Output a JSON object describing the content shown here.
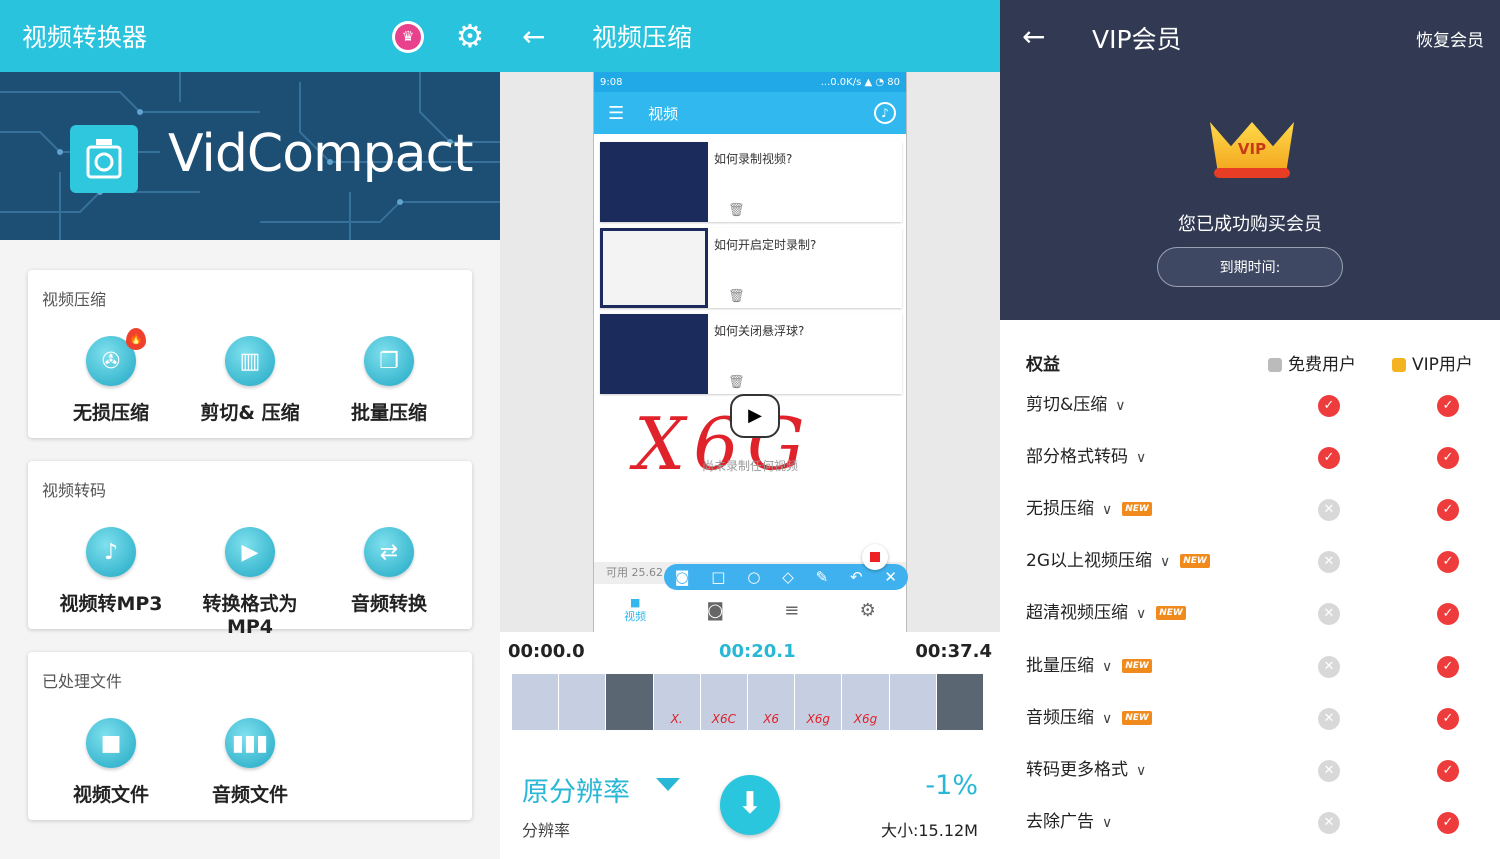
{
  "panel1": {
    "title": "视频转换器",
    "banner_brand": "VidCompact",
    "cards": [
      {
        "label": "视频压缩",
        "items": [
          "无损压缩",
          "剪切& 压缩",
          "批量压缩"
        ]
      },
      {
        "label": "视频转码",
        "items": [
          "视频转MP3",
          "转换格式为MP4",
          "音频转换"
        ]
      },
      {
        "label": "已处理文件",
        "items": [
          "视频文件",
          "音频文件"
        ]
      }
    ]
  },
  "panel2": {
    "title": "视频压缩",
    "phone": {
      "time": "9:08",
      "net": "...0.0K/s",
      "battery": "80",
      "tab_title": "视频",
      "videos": [
        "如何录制视频?",
        "如何开启定时录制?",
        "如何关闭悬浮球?"
      ],
      "empty_text": "尚未录制任何视频",
      "scrawl": "X6G",
      "storage": "可用 25.62 GB / 共 51.54 GB",
      "nav_active": "视频"
    },
    "timeline": {
      "start": "00:00.0",
      "current": "00:20.1",
      "end": "00:37.4"
    },
    "film_marks": [
      "",
      "",
      "",
      "X.",
      "X6C",
      "X6",
      "X6g",
      "X6g",
      "",
      ""
    ],
    "resolution": "原分辨率",
    "resolution_label": "分辨率",
    "percent": "-1%",
    "size": "大小:15.12M"
  },
  "panel3": {
    "title": "VIP会员",
    "restore": "恢复会员",
    "crown_text": "VIP",
    "message": "您已成功购买会员",
    "expire": "到期时间:",
    "header_benefit": "权益",
    "header_free": "免费用户",
    "header_vip": "VIP用户",
    "benefits": [
      {
        "name": "剪切&压缩",
        "new": "",
        "free": "✓",
        "vip": "✓"
      },
      {
        "name": "部分格式转码",
        "new": "",
        "free": "✓",
        "vip": "✓"
      },
      {
        "name": "无损压缩",
        "new": "NEW",
        "free": "✕",
        "vip": "✓"
      },
      {
        "name": "2G以上视频压缩",
        "new": "NEW",
        "free": "✕",
        "vip": "✓"
      },
      {
        "name": "超清视频压缩",
        "new": "NEW",
        "free": "✕",
        "vip": "✓"
      },
      {
        "name": "批量压缩",
        "new": "NEW",
        "free": "✕",
        "vip": "✓"
      },
      {
        "name": "音频压缩",
        "new": "NEW",
        "free": "✕",
        "vip": "✓"
      },
      {
        "name": "转码更多格式",
        "new": "",
        "free": "✕",
        "vip": "✓"
      },
      {
        "name": "去除广告",
        "new": "",
        "free": "✕",
        "vip": "✓"
      }
    ]
  },
  "colors": {
    "teal": "#29c3dd",
    "vip_bg": "#313a52",
    "check": "#ee3b3b",
    "new_badge": "#f08a1c"
  }
}
